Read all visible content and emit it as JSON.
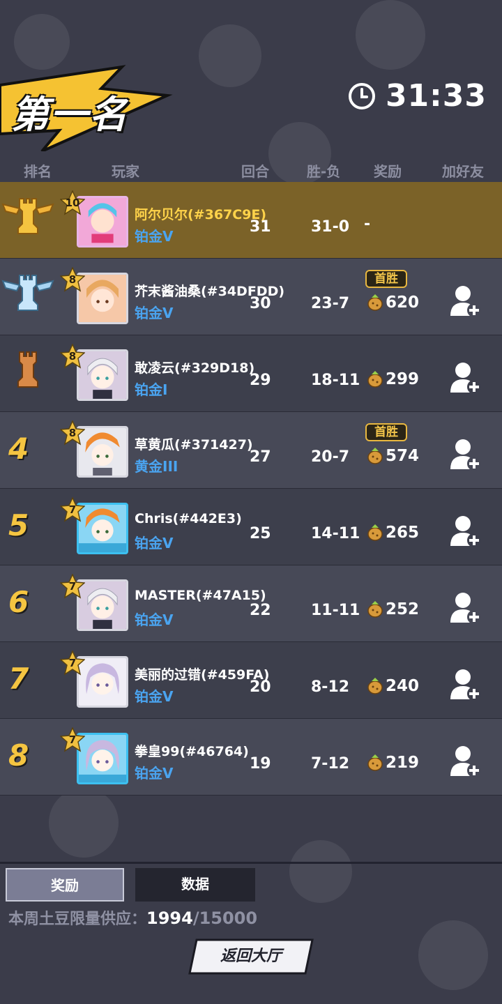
{
  "header": {
    "title": "第一名",
    "timer": "31:33"
  },
  "columns": [
    "排名",
    "玩家",
    "回合",
    "胜-负",
    "奖励",
    "加好友"
  ],
  "rows": [
    {
      "rank": "1",
      "level": "10",
      "name": "阿尔贝尔(#367C9E)",
      "tier": "铂金V",
      "rounds": "31",
      "winloss": "31-0",
      "reward": "-",
      "first_win": ""
    },
    {
      "rank": "2",
      "level": "8",
      "name": "芥末酱油桑(#34DFDD)",
      "tier": "铂金V",
      "rounds": "30",
      "winloss": "23-7",
      "reward": "620",
      "first_win": "首胜"
    },
    {
      "rank": "3",
      "level": "8",
      "name": "敢凌云(#329D18)",
      "tier": "铂金I",
      "rounds": "29",
      "winloss": "18-11",
      "reward": "299",
      "first_win": ""
    },
    {
      "rank": "4",
      "level": "8",
      "name": "草黄瓜(#371427)",
      "tier": "黄金III",
      "rounds": "27",
      "winloss": "20-7",
      "reward": "574",
      "first_win": "首胜"
    },
    {
      "rank": "5",
      "level": "7",
      "name": "Chris(#442E3)",
      "tier": "铂金V",
      "rounds": "25",
      "winloss": "14-11",
      "reward": "265",
      "first_win": ""
    },
    {
      "rank": "6",
      "level": "7",
      "name": "MASTER(#47A15)",
      "tier": "铂金V",
      "rounds": "22",
      "winloss": "11-11",
      "reward": "252",
      "first_win": ""
    },
    {
      "rank": "7",
      "level": "7",
      "name": "美丽的过错(#459FA)",
      "tier": "铂金V",
      "rounds": "20",
      "winloss": "8-12",
      "reward": "240",
      "first_win": ""
    },
    {
      "rank": "8",
      "level": "7",
      "name": "拳皇99(#46764)",
      "tier": "铂金V",
      "rounds": "19",
      "winloss": "7-12",
      "reward": "219",
      "first_win": ""
    }
  ],
  "tabs": {
    "reward": "奖励",
    "data": "数据"
  },
  "supply": {
    "label": "本周土豆限量供应：",
    "current": "1994",
    "total": "/15000"
  },
  "return_button": "返回大厅",
  "colors": {
    "highlight": "#7b6228",
    "tier": "#4aa4f0",
    "rank": "#f5c541"
  },
  "icons": [
    "clock-icon",
    "gold-rook-icon",
    "silver-rook-icon",
    "bronze-rook-icon",
    "potato-coin-icon",
    "add-friend-icon"
  ]
}
